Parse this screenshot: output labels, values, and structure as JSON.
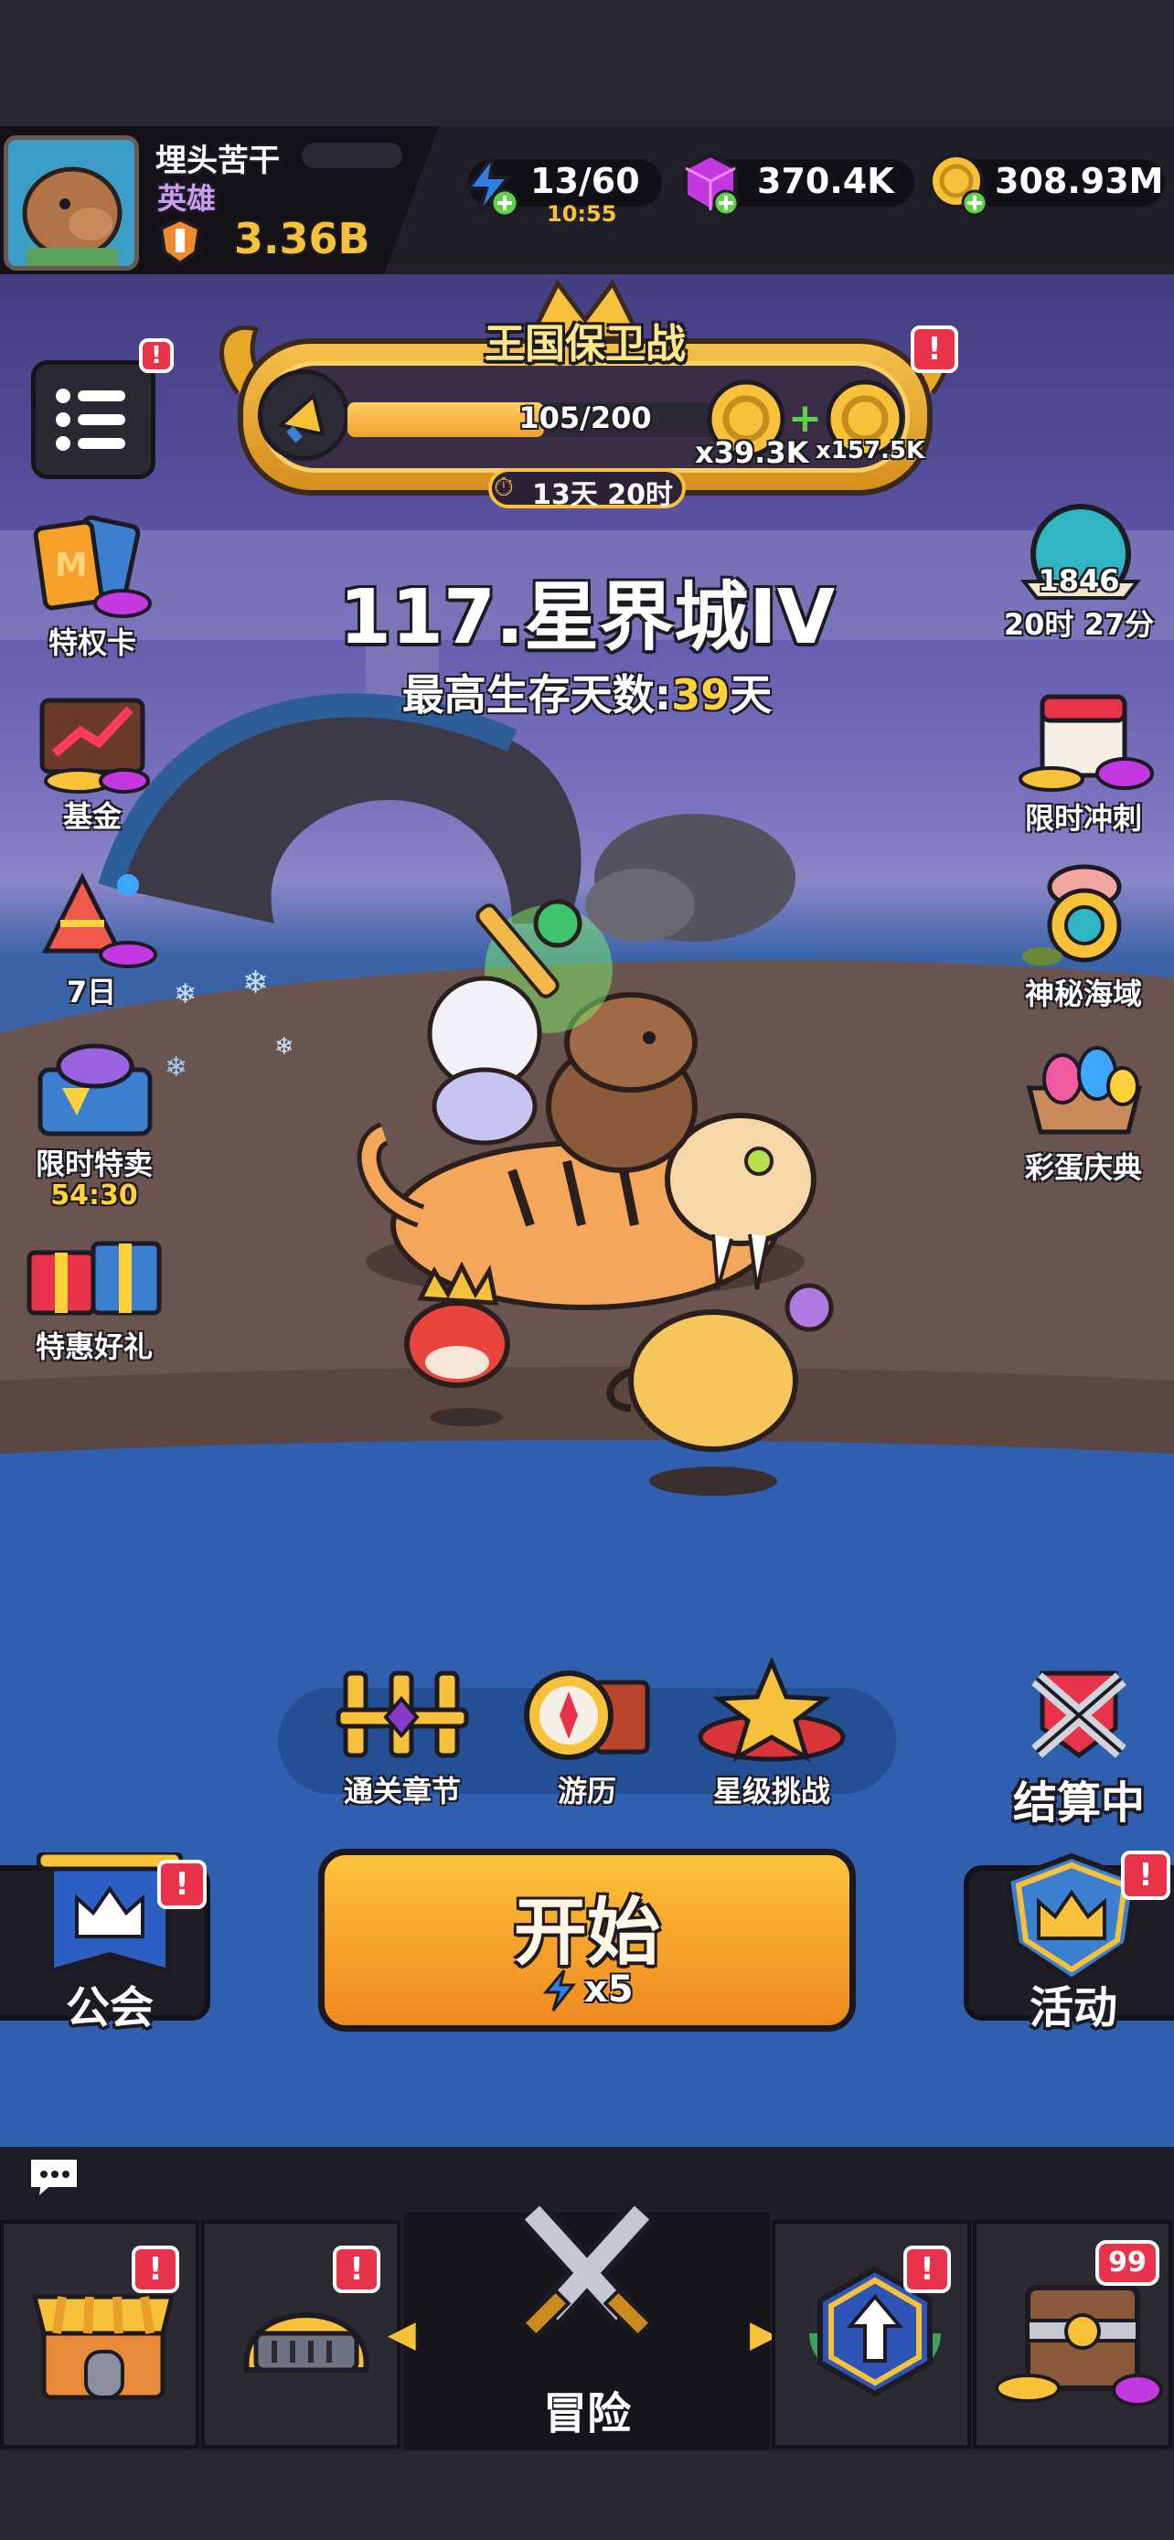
{
  "player": {
    "name": "埋头苦干",
    "rank": "英雄",
    "power": "3.36B"
  },
  "resources": {
    "energy": "13/60",
    "energy_timer": "10:55",
    "gems": "370.4K",
    "coins": "308.93M"
  },
  "kingdom_event": {
    "title": "王国保卫战",
    "progress": "105/200",
    "progress_fraction": 0.525,
    "reward_1": "x39.3K",
    "reward_2": "x157.5K",
    "timer": "13天 20时"
  },
  "stage": {
    "title": "117.星界城IV",
    "survival_label": "最高生存天数:",
    "survival_days": "39",
    "survival_unit": "天"
  },
  "left_side": [
    {
      "label": "特权卡",
      "icon": "privilege-card-icon"
    },
    {
      "label": "基金",
      "icon": "fund-chart-icon"
    },
    {
      "label": "7日",
      "icon": "seven-day-party-icon"
    },
    {
      "label": "限时特卖",
      "timer": "54:30",
      "icon": "flash-sale-icon"
    },
    {
      "label": "特惠好礼",
      "icon": "gift-box-icon"
    }
  ],
  "right_side": [
    {
      "value": "1846",
      "timer": "20时 27分",
      "icon": "globe-icon"
    },
    {
      "label": "限时冲刺",
      "icon": "calendar-sprint-icon"
    },
    {
      "label": "神秘海域",
      "icon": "mystery-sea-icon"
    },
    {
      "label": "彩蛋庆典",
      "icon": "easter-egg-basket-icon"
    }
  ],
  "mode_row": [
    {
      "label": "通关章节",
      "icon": "chapter-gate-icon"
    },
    {
      "label": "游历",
      "icon": "compass-book-icon"
    },
    {
      "label": "星级挑战",
      "icon": "star-challenge-icon"
    }
  ],
  "settlement_label": "结算中",
  "guild_label": "公会",
  "activity_label": "活动",
  "start": {
    "label": "开始",
    "cost": "x5"
  },
  "bottom_nav": {
    "center_label": "冒险",
    "chest_badge": "99"
  },
  "colors": {
    "gold": "#f7c23a",
    "badge_red": "#e8334a",
    "survival_days_yellow": "#ffd23b",
    "rank_purple": "#c99cf2"
  }
}
